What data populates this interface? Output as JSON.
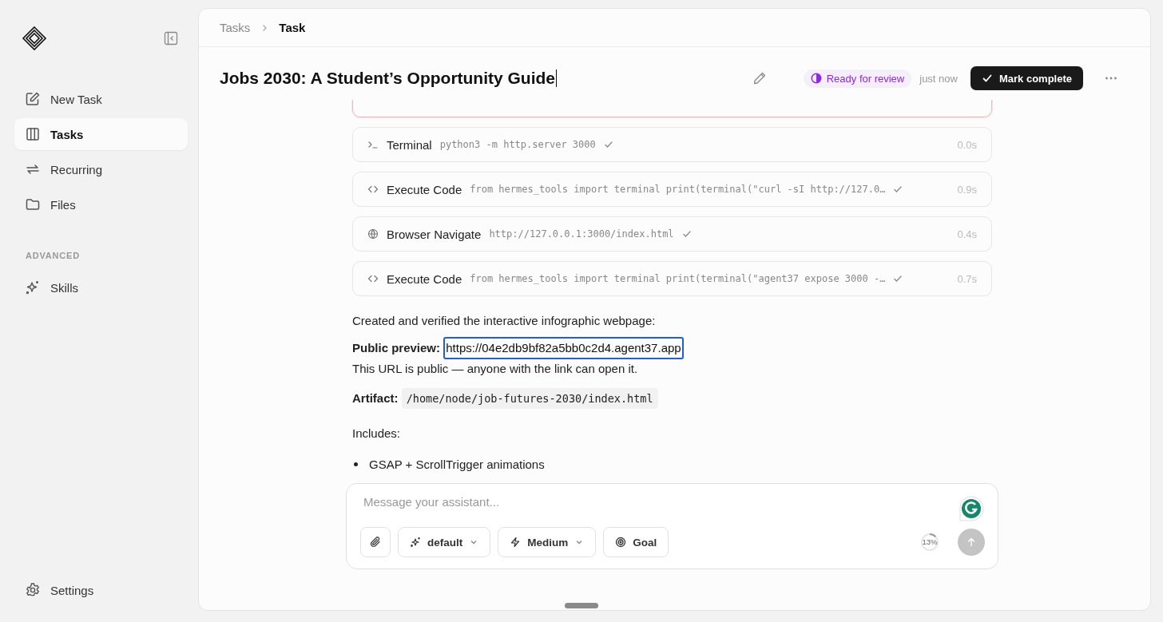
{
  "sidebar": {
    "items": [
      {
        "label": "New Task",
        "selected": false
      },
      {
        "label": "Tasks",
        "selected": true
      },
      {
        "label": "Recurring",
        "selected": false
      },
      {
        "label": "Files",
        "selected": false
      }
    ],
    "section_label": "ADVANCED",
    "advanced_items": [
      {
        "label": "Skills",
        "selected": false
      }
    ],
    "settings": {
      "label": "Settings"
    }
  },
  "breadcrumb": [
    "Tasks",
    "Task"
  ],
  "task": {
    "title": "Jobs 2030: A Student’s Opportunity Guide",
    "status": "Ready for review",
    "time": "just now",
    "complete_button": "Mark complete"
  },
  "tool_calls": [
    {
      "kind": "hidden",
      "failed": true
    },
    {
      "kind": "terminal",
      "name": "Terminal",
      "args": "python3 -m http.server 3000",
      "failed": false,
      "duration": "0.0s"
    },
    {
      "kind": "code",
      "name": "Execute Code",
      "args": "from hermes_tools import terminal print(terminal(\"curl -sI http://127.0…",
      "failed": false,
      "duration": "0.9s"
    },
    {
      "kind": "browser",
      "name": "Browser Navigate",
      "args": "http://127.0.0.1:3000/index.html",
      "failed": false,
      "duration": "0.4s"
    },
    {
      "kind": "code",
      "name": "Execute Code",
      "args": "from hermes_tools import terminal print(terminal(\"agent37 expose 3000 -…",
      "failed": false,
      "duration": "0.7s"
    }
  ],
  "message": {
    "intro": "Created and verified the interactive infographic webpage:",
    "preview_label": "Public preview:",
    "preview_link": "https://04e2db9bf82a5bb0c2d4.agent37.app",
    "preview_note": "This URL is public — anyone with the link can open it.",
    "artifact_label": "Artifact:",
    "artifact_path": "/home/node/job-futures-2030/index.html",
    "includes_label": "Includes:",
    "bullets": [
      "GSAP + ScrollTrigger animations"
    ]
  },
  "composer": {
    "placeholder": "Message your assistant...",
    "mode": "default",
    "effort": "Medium",
    "goal": "Goal",
    "context_usage": "13%",
    "level": 0.13,
    "send_disabled": true
  }
}
